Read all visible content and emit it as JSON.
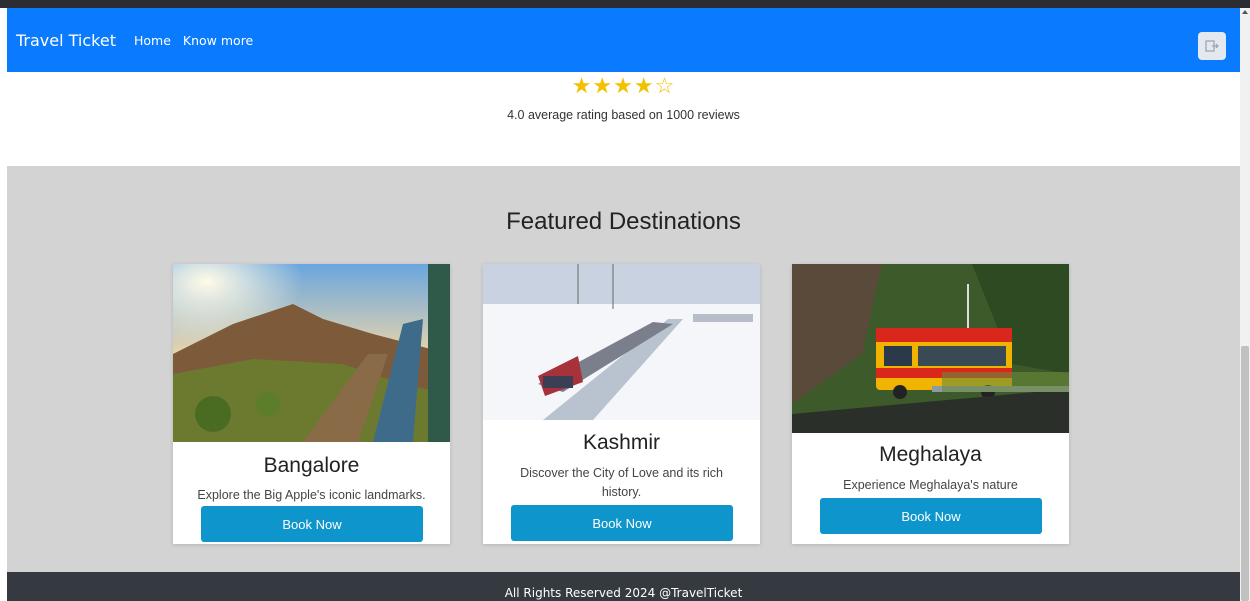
{
  "nav": {
    "brand": "Travel Ticket",
    "links": [
      "Home",
      "Know more"
    ],
    "logout_icon": "logout-icon"
  },
  "rating": {
    "stars_filled": 4,
    "stars_total": 5,
    "stars_text": "★★★★☆",
    "text": "4.0 average rating based on 1000 reviews"
  },
  "featured": {
    "title": "Featured Destinations",
    "cards": [
      {
        "title": "Bangalore",
        "description": "Explore the Big Apple's iconic landmarks.",
        "button": "Book Now"
      },
      {
        "title": "Kashmir",
        "description": "Discover the City of Love and its rich history.",
        "button": "Book Now"
      },
      {
        "title": "Meghalaya",
        "description": "Experience Meghalaya's nature",
        "button": "Book Now"
      }
    ]
  },
  "footer": {
    "text": "All Rights Reserved 2024 @TravelTicket"
  },
  "colors": {
    "navbar": "#0a7bff",
    "button": "#0d95cc",
    "footer": "#343a40",
    "section_bg": "#d3d3d3",
    "star": "#f2c200"
  }
}
